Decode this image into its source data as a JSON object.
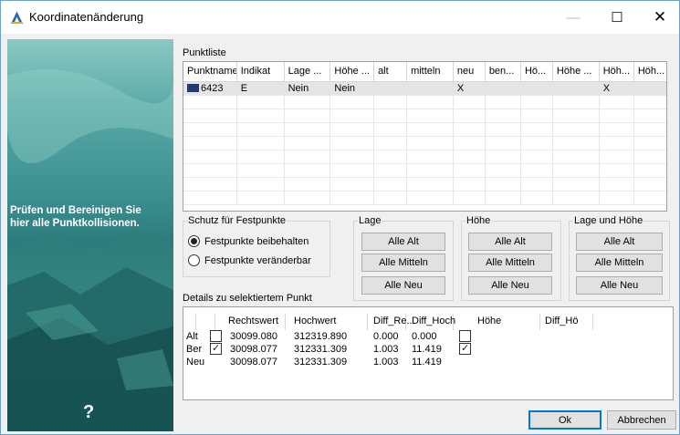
{
  "window": {
    "title": "Koordinatenänderung",
    "minimize": "—",
    "maximize": "☐",
    "close": "✕"
  },
  "sidebar": {
    "text_line1": "Prüfen und Bereinigen Sie",
    "text_line2": "hier alle Punktkollisionen.",
    "help": "?"
  },
  "punktliste": {
    "label": "Punktliste",
    "columns": [
      "Punktname",
      "Indikat",
      "Lage ...",
      "Höhe ...",
      "alt",
      "mitteln",
      "neu",
      "ben...",
      "Hö...",
      "Höhe ...",
      "Höh...",
      "Höh..."
    ],
    "rows": [
      [
        "6423",
        "E",
        "Nein",
        "Nein",
        "",
        "",
        "X",
        "",
        "",
        "",
        "X",
        ""
      ]
    ]
  },
  "schutz": {
    "legend": "Schutz für Festpunkte",
    "option1": "Festpunkte beibehalten",
    "option2": "Festpunkte veränderbar",
    "selected": "option1"
  },
  "lage": {
    "legend": "Lage",
    "alt": "Alle Alt",
    "mitteln": "Alle Mitteln",
    "neu": "Alle Neu"
  },
  "hoehe": {
    "legend": "Höhe",
    "alt": "Alle Alt",
    "mitteln": "Alle Mitteln",
    "neu": "Alle Neu"
  },
  "lageundhoehe": {
    "legend": "Lage und Höhe",
    "alt": "Alle Alt",
    "mitteln": "Alle Mitteln",
    "neu": "Alle Neu"
  },
  "details": {
    "label": "Details zu selektiertem Punkt",
    "headers": [
      "Rechtswert",
      "Hochwert",
      "Diff_Re...",
      "Diff_Hoch",
      "Höhe",
      "Diff_Hö"
    ],
    "rows": [
      {
        "name": "Alt",
        "check1": false,
        "rechts": "30099.080",
        "hoch": "312319.890",
        "diff_re": "0.000",
        "diff_hoch": "0.000",
        "check2": false
      },
      {
        "name": "Ber",
        "check1": true,
        "rechts": "30098.077",
        "hoch": "312331.309",
        "diff_re": "1.003",
        "diff_hoch": "11.419",
        "check2": true
      },
      {
        "name": "Neu",
        "rechts": "30098.077",
        "hoch": "312331.309",
        "diff_re": "1.003",
        "diff_hoch": "11.419"
      }
    ]
  },
  "buttons": {
    "ok": "Ok",
    "cancel": "Abbrechen"
  },
  "colors": {
    "accent": "#0078d7",
    "sidebar": "#3b8f90",
    "rowmark": "#1e3c6e"
  }
}
